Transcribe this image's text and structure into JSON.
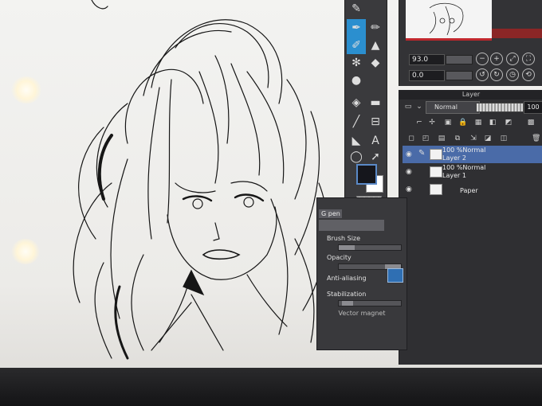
{
  "navigator": {
    "zoom_value": "93.0",
    "rotate_value": "0.0",
    "buttons": [
      "−",
      "+",
      "⤢",
      "⛶",
      "↺",
      "↻",
      "◷",
      "⟲"
    ]
  },
  "layer_panel": {
    "title": "Layer",
    "blend_mode": "Normal",
    "opacity": "100",
    "layers": [
      {
        "line1": "100 %Normal",
        "line2": "Layer 2",
        "selected": true
      },
      {
        "line1": "100 %Normal",
        "line2": "Layer 1",
        "selected": false
      },
      {
        "line1": "",
        "line2": "Paper",
        "selected": false
      }
    ]
  },
  "tool_property": {
    "tab": "G pen",
    "brush_size_label": "Brush Size",
    "opacity_label": "Opacity",
    "anti_aliasing_label": "Anti-aliasing",
    "stabilization_label": "Stabilization",
    "vector_magnet_label": "Vector magnet"
  },
  "tools": {
    "icons": [
      "eyedropper-icon",
      "pen-icon",
      "pencil-icon",
      "brush-icon",
      "marker-icon",
      "airbrush-icon",
      "decoration-icon",
      "eraser-icon",
      "blend-icon",
      "fill-icon",
      "gradient-icon",
      "figure-icon",
      "frame-icon",
      "ruler-icon",
      "text-icon",
      "balloon-icon",
      "correct-line-icon",
      "move-icon"
    ]
  },
  "colors": {
    "main": "#15161c",
    "sub": "#ffffff",
    "accent": "#2b8fcf",
    "selection": "#4a6ba8"
  }
}
